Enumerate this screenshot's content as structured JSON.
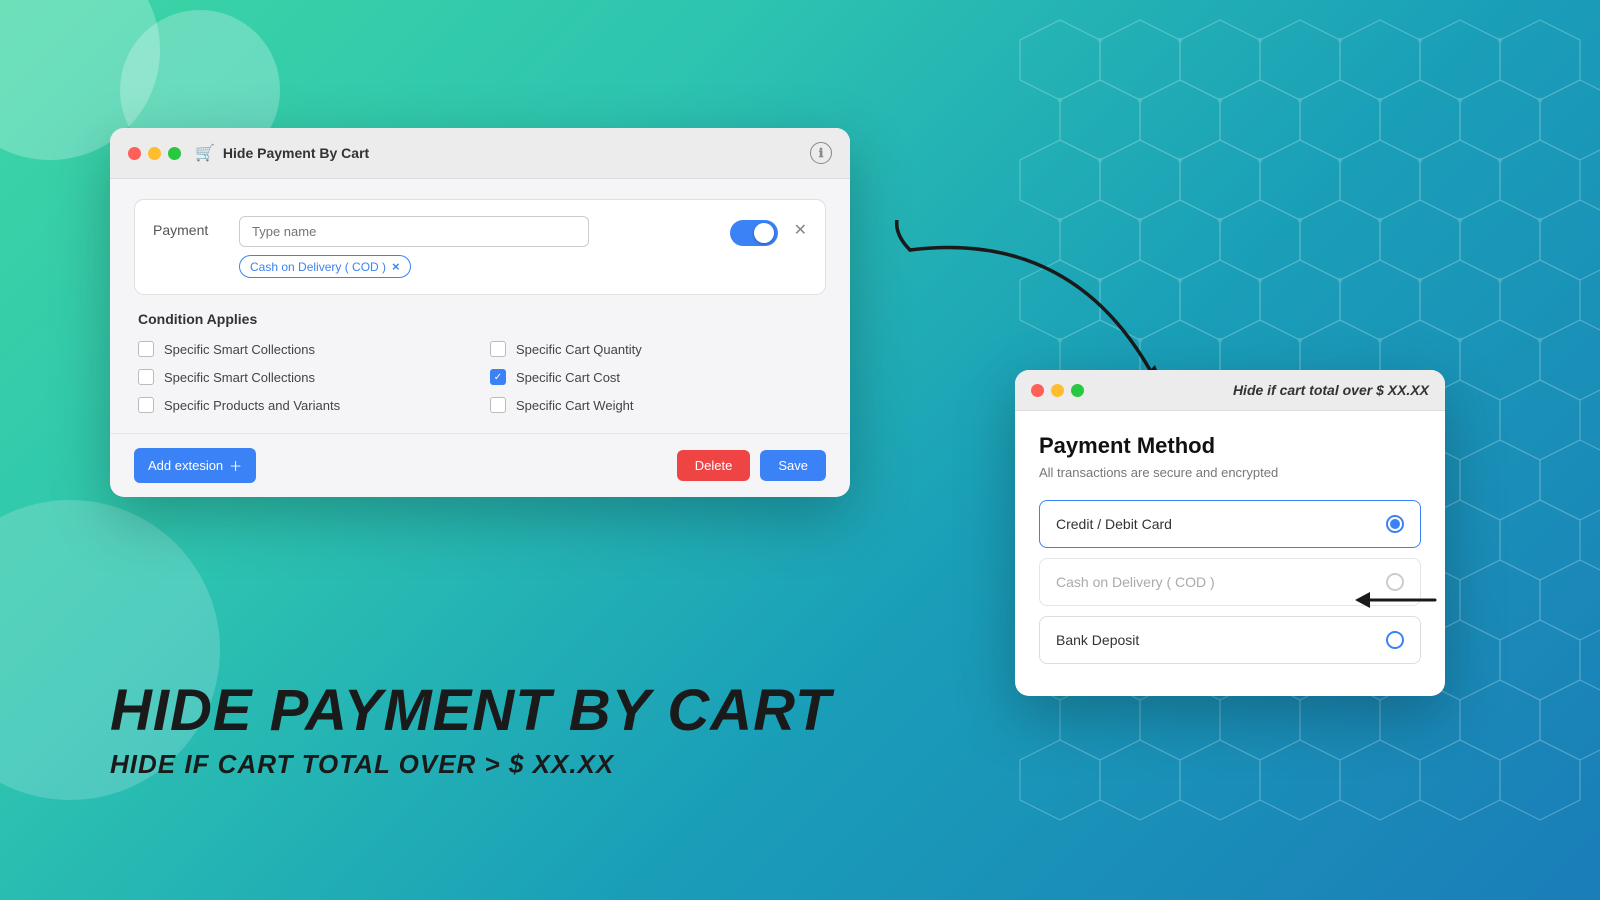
{
  "background": {
    "gradient_start": "#3dd6a3",
    "gradient_end": "#1a7db8"
  },
  "admin_window": {
    "title": "Hide Payment By Cart",
    "info_icon": "ℹ",
    "payment_label": "Payment",
    "payment_input_placeholder": "Type name",
    "cod_tag": "Cash on Delivery ( COD )",
    "condition_title": "Condition Applies",
    "conditions": [
      {
        "label": "Specific Smart Collections",
        "checked": false,
        "col": 1
      },
      {
        "label": "Specific Cart Quantity",
        "checked": false,
        "col": 2
      },
      {
        "label": "Specific Smart Collections",
        "checked": false,
        "col": 1
      },
      {
        "label": "Specific Cart Cost",
        "checked": true,
        "col": 2
      },
      {
        "label": "Specific Products and Variants",
        "checked": false,
        "col": 1
      },
      {
        "label": "Specific Cart Weight",
        "checked": false,
        "col": 2
      }
    ],
    "add_extension_label": "Add extesion",
    "delete_label": "Delete",
    "save_label": "Save"
  },
  "payment_method_window": {
    "annotation": "Hide if cart total over $ XX.XX",
    "heading": "Payment Method",
    "subtitle": "All transactions are secure and encrypted",
    "options": [
      {
        "label": "Credit / Debit Card",
        "selected": true,
        "disabled": false
      },
      {
        "label": "Cash on Delivery ( COD )",
        "selected": false,
        "disabled": true
      },
      {
        "label": "Bank Deposit",
        "selected": false,
        "disabled": false
      }
    ]
  },
  "headline": {
    "main": "HIDE PAYMENT BY CART",
    "sub": "HIDE IF CART TOTAL OVER > $ XX.XX"
  }
}
